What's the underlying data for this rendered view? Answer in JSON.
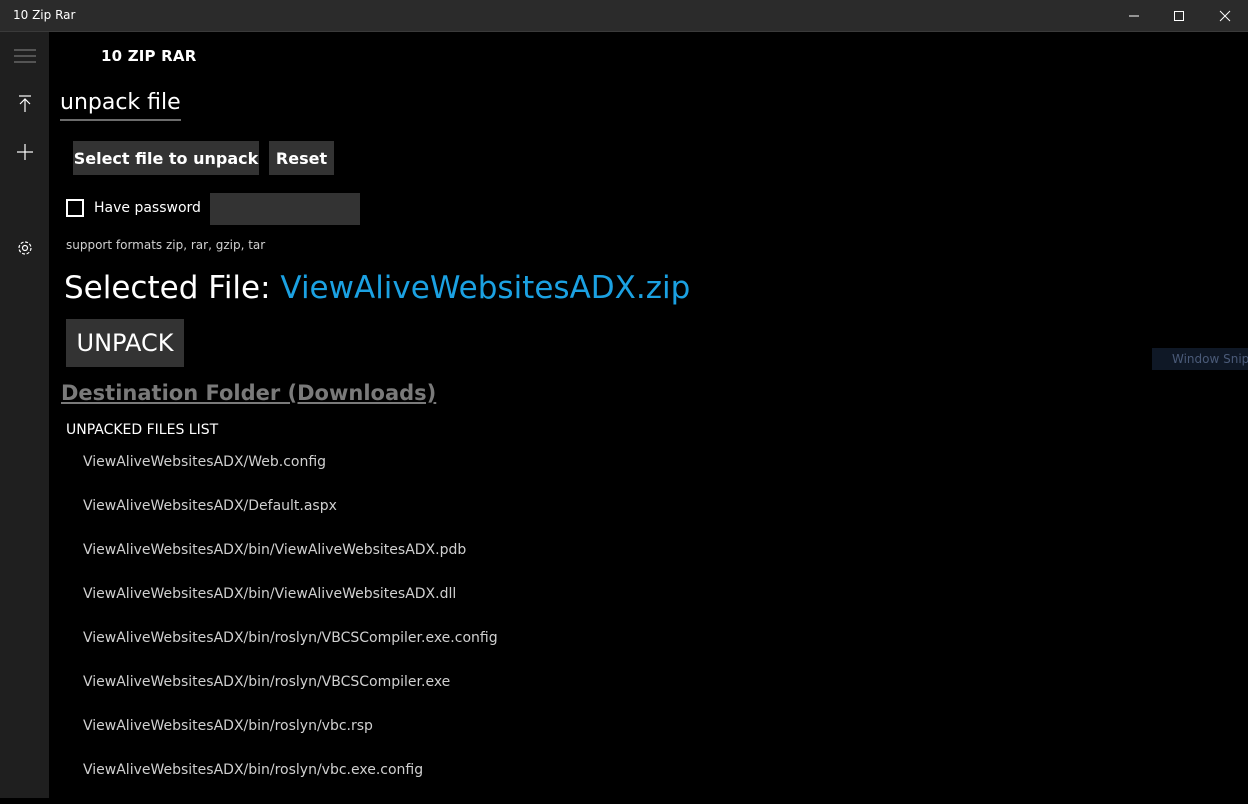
{
  "window": {
    "title": "10 Zip Rar"
  },
  "app": {
    "name": "10 ZIP RAR"
  },
  "page": {
    "title": "unpack file"
  },
  "actions": {
    "select_file": "Select file to unpack",
    "reset": "Reset",
    "unpack": "UNPACK"
  },
  "password": {
    "checkbox_label": "Have password",
    "value": ""
  },
  "formats_note": "support formats zip, rar, gzip, tar",
  "selected_file": {
    "label": "Selected File:",
    "name": "ViewAliveWebsitesADX.zip"
  },
  "destination": {
    "label": "Destination Folder (Downloads)"
  },
  "files_list": {
    "header": "UNPACKED FILES LIST",
    "items": [
      "ViewAliveWebsitesADX/Web.config",
      "ViewAliveWebsitesADX/Default.aspx",
      "ViewAliveWebsitesADX/bin/ViewAliveWebsitesADX.pdb",
      "ViewAliveWebsitesADX/bin/ViewAliveWebsitesADX.dll",
      "ViewAliveWebsitesADX/bin/roslyn/VBCSCompiler.exe.config",
      "ViewAliveWebsitesADX/bin/roslyn/VBCSCompiler.exe",
      "ViewAliveWebsitesADX/bin/roslyn/vbc.rsp",
      "ViewAliveWebsitesADX/bin/roslyn/vbc.exe.config"
    ]
  },
  "overlay": {
    "snip_label": "Window Snip"
  },
  "colors": {
    "accent": "#1ba1e2",
    "sidebar": "#1f1f1f",
    "button": "#333333"
  }
}
